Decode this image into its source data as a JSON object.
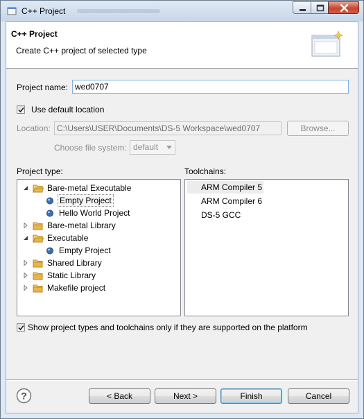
{
  "window": {
    "title": "C++ Project"
  },
  "header": {
    "title": "C++ Project",
    "subtitle": "Create C++ project of selected type"
  },
  "form": {
    "project_name_label": "Project name:",
    "project_name_value": "wed0707",
    "use_default_location_label": "Use default location",
    "use_default_location_checked": true,
    "location_label": "Location:",
    "location_value": "C:\\Users\\USER\\Documents\\DS-5 Workspace\\wed0707",
    "browse_label": "Browse...",
    "file_system_label": "Choose file system:",
    "file_system_value": "default"
  },
  "project_type": {
    "label": "Project type:",
    "items": [
      {
        "label": "Bare-metal Executable",
        "kind": "folder",
        "expanded": true
      },
      {
        "label": "Empty Project",
        "kind": "leaf",
        "selected": true
      },
      {
        "label": "Hello World Project",
        "kind": "leaf"
      },
      {
        "label": "Bare-metal Library",
        "kind": "folder",
        "expanded": false
      },
      {
        "label": "Executable",
        "kind": "folder",
        "expanded": true
      },
      {
        "label": "Empty Project",
        "kind": "leaf"
      },
      {
        "label": "Shared Library",
        "kind": "folder",
        "expanded": false
      },
      {
        "label": "Static Library",
        "kind": "folder",
        "expanded": false
      },
      {
        "label": "Makefile project",
        "kind": "folder",
        "expanded": false
      }
    ]
  },
  "toolchains": {
    "label": "Toolchains:",
    "items": [
      {
        "label": "ARM Compiler 5",
        "selected": true
      },
      {
        "label": "ARM Compiler 6"
      },
      {
        "label": "DS-5 GCC"
      }
    ]
  },
  "filter": {
    "label": "Show project types and toolchains only if they are supported on the platform",
    "checked": true
  },
  "buttons": {
    "back": "< Back",
    "next": "Next >",
    "finish": "Finish",
    "cancel": "Cancel"
  },
  "colors": {
    "folder": "#e8b64c",
    "leaf_bullet": "#3a6fb8",
    "close_button": "#c8452e"
  }
}
